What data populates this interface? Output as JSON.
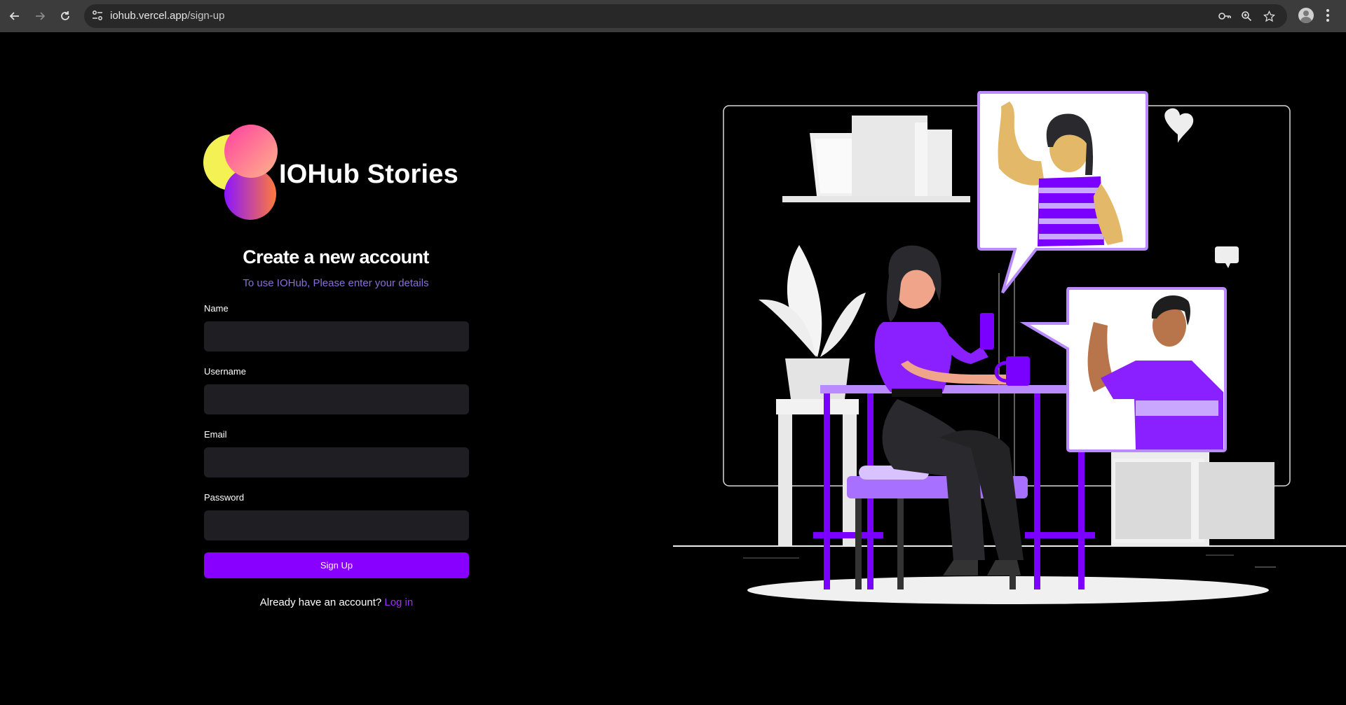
{
  "browser": {
    "url_domain": "iohub.vercel.app",
    "url_path": "/sign-up"
  },
  "brand": {
    "name": "IOHub Stories"
  },
  "form": {
    "title": "Create a new account",
    "subtitle": "To use IOHub, Please enter your details",
    "fields": {
      "name": {
        "label": "Name",
        "value": "",
        "placeholder": ""
      },
      "username": {
        "label": "Username",
        "value": "",
        "placeholder": ""
      },
      "email": {
        "label": "Email",
        "value": "",
        "placeholder": ""
      },
      "password": {
        "label": "Password",
        "value": "",
        "placeholder": ""
      }
    },
    "submit_label": "Sign Up",
    "footer_text": "Already have an account?",
    "footer_link": "Log in"
  },
  "icons": {
    "back": "back-arrow-icon",
    "forward": "forward-arrow-icon",
    "reload": "reload-icon",
    "site_info": "tune-icon",
    "password_manager": "key-icon",
    "zoom": "zoom-icon",
    "bookmark": "star-icon",
    "profile": "avatar-icon",
    "menu": "kebab-menu-icon"
  },
  "colors": {
    "accent": "#8800ff",
    "link": "#9a30ff",
    "subtitle": "#8a6fd6",
    "input_bg": "#1f1f23",
    "background": "#000000"
  }
}
